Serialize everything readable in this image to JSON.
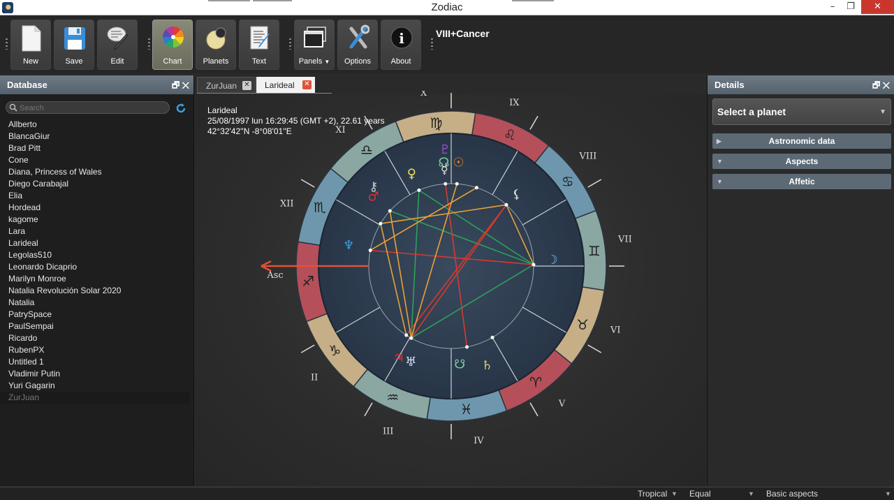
{
  "window": {
    "title": "Zodiac",
    "minimize": "–",
    "maximize": "❐",
    "close": "✕"
  },
  "toolbar": {
    "buttons": [
      {
        "label": "New",
        "icon": "new-document-icon"
      },
      {
        "label": "Save",
        "icon": "floppy-disk-icon"
      },
      {
        "label": "Edit",
        "icon": "edit-pen-icon"
      },
      {
        "label": "Chart",
        "icon": "color-wheel-icon",
        "active": true
      },
      {
        "label": "Planets",
        "icon": "planet-icon"
      },
      {
        "label": "Text",
        "icon": "text-document-icon"
      },
      {
        "label": "Panels",
        "icon": "panels-icon",
        "dropdown": true
      },
      {
        "label": "Options",
        "icon": "tools-icon"
      },
      {
        "label": "About",
        "icon": "info-icon"
      }
    ],
    "status": "VIII+Cancer"
  },
  "database": {
    "header": "Database",
    "search_placeholder": "Search",
    "items": [
      "Allberto",
      "BlancaGiur",
      "Brad Pitt",
      "Cone",
      "Diana, Princess of Wales",
      "Diego Carabajal",
      "Elia",
      "Hordead",
      "kagome",
      "Lara",
      "Larideal",
      "Legolas510",
      "Leonardo Dicaprio",
      "Marilyn Monroe",
      "Natalia Revolución Solar 2020",
      "Natalia",
      "PatrySpace",
      "PaulSempai",
      "Ricardo",
      "RubenPX",
      "Untitled 1",
      "Vladimir Putin",
      "Yuri Gagarin",
      "ZurJuan"
    ],
    "selected": "ZurJuan"
  },
  "tabs": [
    {
      "label": "ZurJuan",
      "active": false
    },
    {
      "label": "Larideal",
      "active": true
    }
  ],
  "chart": {
    "name": "Larideal",
    "datetime": "25/08/1997 lun 16:29:45 (GMT +2), 22.61 years",
    "coords": "42°32'42''N  -8°08'01''E",
    "asc_label": "Asc",
    "houses": [
      "II",
      "III",
      "IV",
      "V",
      "VI",
      "VII",
      "VIII",
      "IX",
      "X",
      "XI",
      "XII"
    ],
    "zodiac_signs": [
      "♐",
      "♑",
      "♒",
      "♓",
      "♈",
      "♉",
      "♊",
      "♋",
      "♌",
      "♍",
      "♎",
      "♏"
    ],
    "planet_glyphs": [
      "☉",
      "☽",
      "☿",
      "♀",
      "♂",
      "♃",
      "♄",
      "♅",
      "♆",
      "♇",
      "☊",
      "☋",
      "⚷",
      "⚸"
    ],
    "colors": {
      "fire": "#b5505a",
      "earth": "#c6ae86",
      "air": "#8aa7a2",
      "water": "#6e97ae",
      "trine": "#2ea05a",
      "square": "#d9392f",
      "sextile": "#e8a23a"
    }
  },
  "details": {
    "header": "Details",
    "select_label": "Select a planet",
    "sections": [
      {
        "label": "Astronomic data",
        "arrow": "▶"
      },
      {
        "label": "Aspects",
        "arrow": "▼"
      },
      {
        "label": "Affetic",
        "arrow": "▼"
      }
    ]
  },
  "statusbar": {
    "zodiac": "Tropical",
    "houses": "Equal",
    "aspects": "Basic aspects"
  }
}
